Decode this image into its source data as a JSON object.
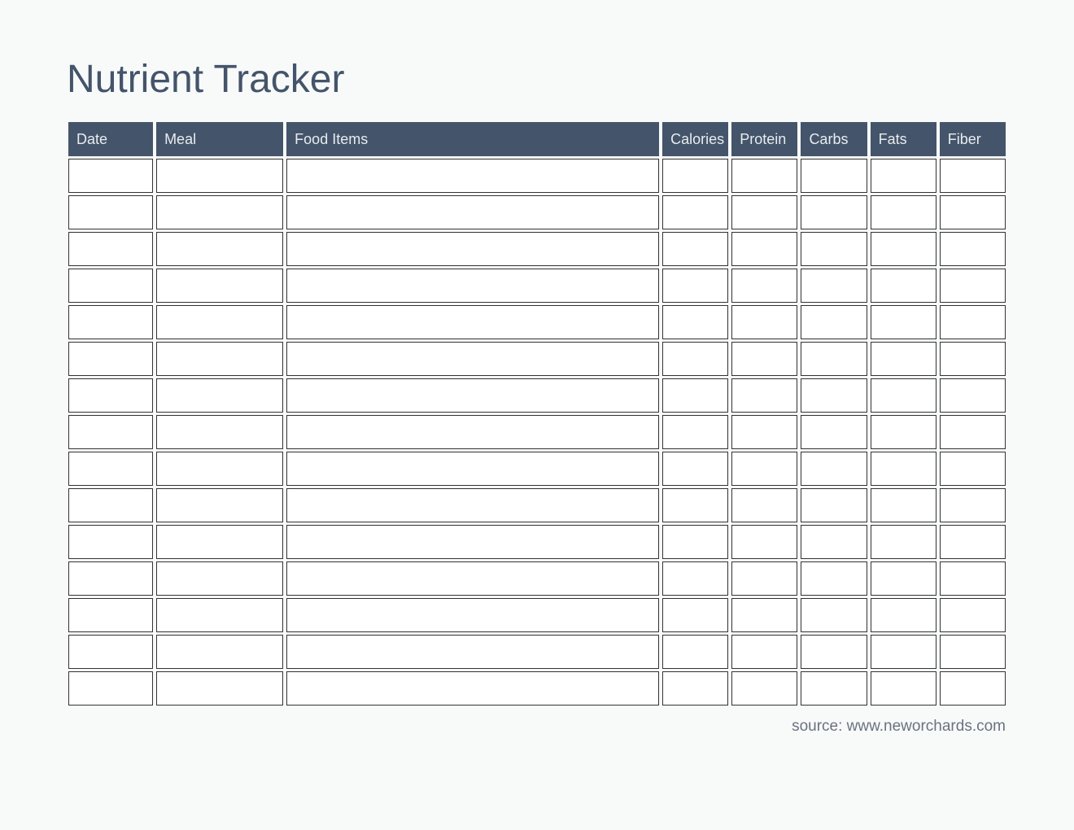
{
  "title": "Nutrient Tracker",
  "columns": [
    "Date",
    "Meal",
    "Food Items",
    "Calories",
    "Protein",
    "Carbs",
    "Fats",
    "Fiber"
  ],
  "rows": [
    [
      "",
      "",
      "",
      "",
      "",
      "",
      "",
      ""
    ],
    [
      "",
      "",
      "",
      "",
      "",
      "",
      "",
      ""
    ],
    [
      "",
      "",
      "",
      "",
      "",
      "",
      "",
      ""
    ],
    [
      "",
      "",
      "",
      "",
      "",
      "",
      "",
      ""
    ],
    [
      "",
      "",
      "",
      "",
      "",
      "",
      "",
      ""
    ],
    [
      "",
      "",
      "",
      "",
      "",
      "",
      "",
      ""
    ],
    [
      "",
      "",
      "",
      "",
      "",
      "",
      "",
      ""
    ],
    [
      "",
      "",
      "",
      "",
      "",
      "",
      "",
      ""
    ],
    [
      "",
      "",
      "",
      "",
      "",
      "",
      "",
      ""
    ],
    [
      "",
      "",
      "",
      "",
      "",
      "",
      "",
      ""
    ],
    [
      "",
      "",
      "",
      "",
      "",
      "",
      "",
      ""
    ],
    [
      "",
      "",
      "",
      "",
      "",
      "",
      "",
      ""
    ],
    [
      "",
      "",
      "",
      "",
      "",
      "",
      "",
      ""
    ],
    [
      "",
      "",
      "",
      "",
      "",
      "",
      "",
      ""
    ],
    [
      "",
      "",
      "",
      "",
      "",
      "",
      "",
      ""
    ]
  ],
  "source": "source: www.neworchards.com"
}
